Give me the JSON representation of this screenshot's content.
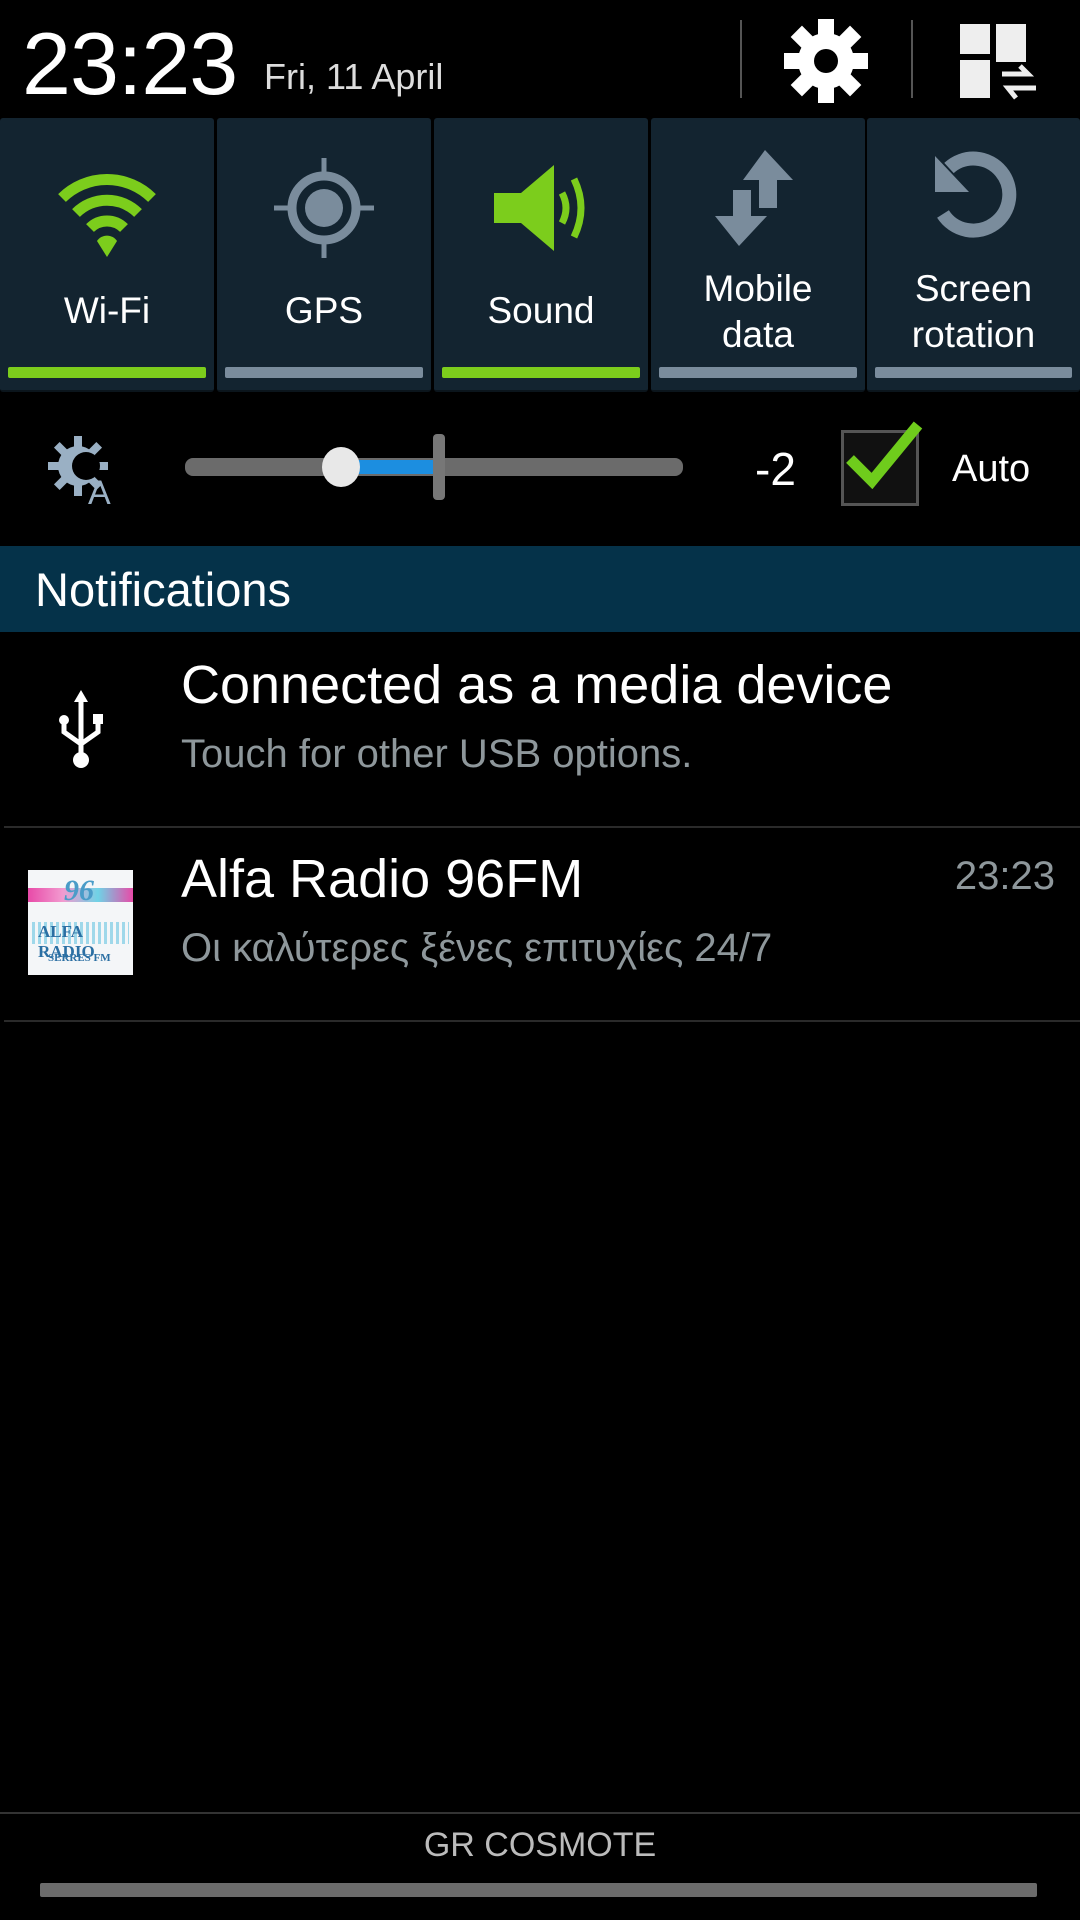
{
  "status": {
    "time": "23:23",
    "date": "Fri, 11 April"
  },
  "header_icons": {
    "settings": "gear-icon",
    "edit_toggles": "grid-swap-icon"
  },
  "quick_toggles": [
    {
      "label": "Wi-Fi",
      "icon": "wifi-icon",
      "on": true
    },
    {
      "label": "GPS",
      "icon": "gps-icon",
      "on": false
    },
    {
      "label": "Sound",
      "icon": "sound-icon",
      "on": true
    },
    {
      "label_line1": "Mobile",
      "label_line2": "data",
      "icon": "mobile-data-icon",
      "on": false
    },
    {
      "label_line1": "Screen",
      "label_line2": "rotation",
      "icon": "screen-rotation-icon",
      "on": false
    }
  ],
  "colors": {
    "on": "#7ccd1c",
    "off": "#7a8c9c",
    "header_bg": "#053249",
    "tile_bg": "#132430",
    "slider_fill": "#1c8ee0"
  },
  "brightness": {
    "value_label": "-2",
    "level": -2,
    "range": [
      -5,
      5
    ],
    "auto_checked": true,
    "auto_label": "Auto"
  },
  "notifications": {
    "header": "Notifications",
    "items": [
      {
        "title": "Connected as a media device",
        "subtitle": "Touch for other USB options.",
        "icon": "usb-icon"
      },
      {
        "title": "Alfa Radio 96FM",
        "subtitle": "Οι καλύτερες ξένες επιτυχίες 24/7",
        "time": "23:23",
        "logo_text": "96 ALFA RADIO SERRES FM"
      }
    ]
  },
  "carrier": "GR COSMOTE"
}
